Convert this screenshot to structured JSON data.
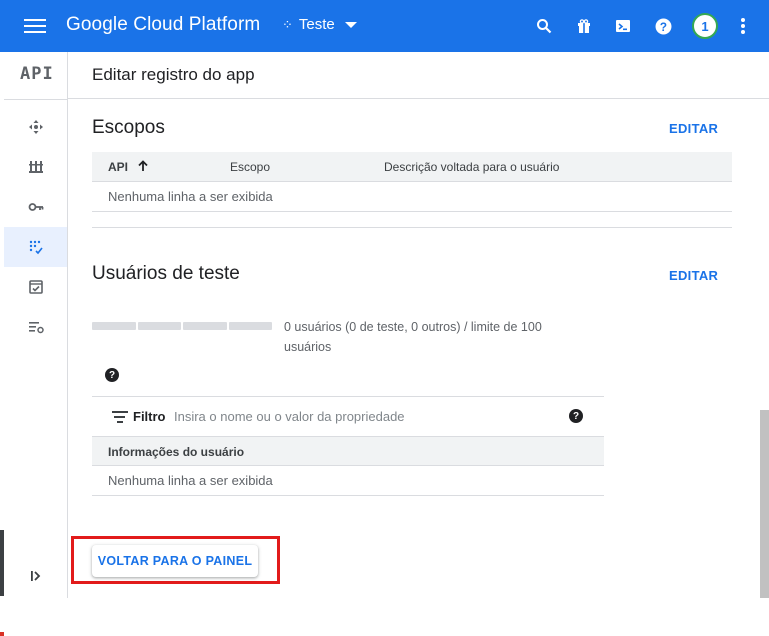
{
  "topbar": {
    "brand": "Google Cloud Platform",
    "project_name": "Teste",
    "icons": [
      "menu-icon",
      "search-icon",
      "gift-icon",
      "cloud-shell-icon",
      "help-icon",
      "more-vert-icon"
    ],
    "notification_count": "1",
    "accent_color": "#1a73e8"
  },
  "sidebar": {
    "title": "API",
    "items": [
      {
        "icon": "dashboard-icon"
      },
      {
        "icon": "library-icon"
      },
      {
        "icon": "key-icon"
      },
      {
        "icon": "consent-screen-icon",
        "active": true
      },
      {
        "icon": "domain-verification-icon"
      },
      {
        "icon": "settings-list-icon"
      }
    ],
    "expand_icon": "expand-sidebar-icon"
  },
  "header": {
    "title": "Editar registro do app"
  },
  "scopes": {
    "title": "Escopos",
    "edit_label": "EDITAR",
    "columns": [
      "API",
      "Escopo",
      "Descrição voltada para o usuário"
    ],
    "empty_text": "Nenhuma linha a ser exibida"
  },
  "test_users": {
    "title": "Usuários de teste",
    "edit_label": "EDITAR",
    "quota_text": "0 usuários (0 de teste, 0 outros) / limite de 100 usuários",
    "quota_used": 0,
    "quota_limit": 100,
    "filter_label": "Filtro",
    "filter_placeholder": "Insira o nome ou o valor da propriedade",
    "column": "Informações do usuário",
    "empty_text": "Nenhuma linha a ser exibida"
  },
  "back_button": {
    "label": "VOLTAR PARA O PAINEL",
    "highlight_color": "#e21b1b"
  }
}
